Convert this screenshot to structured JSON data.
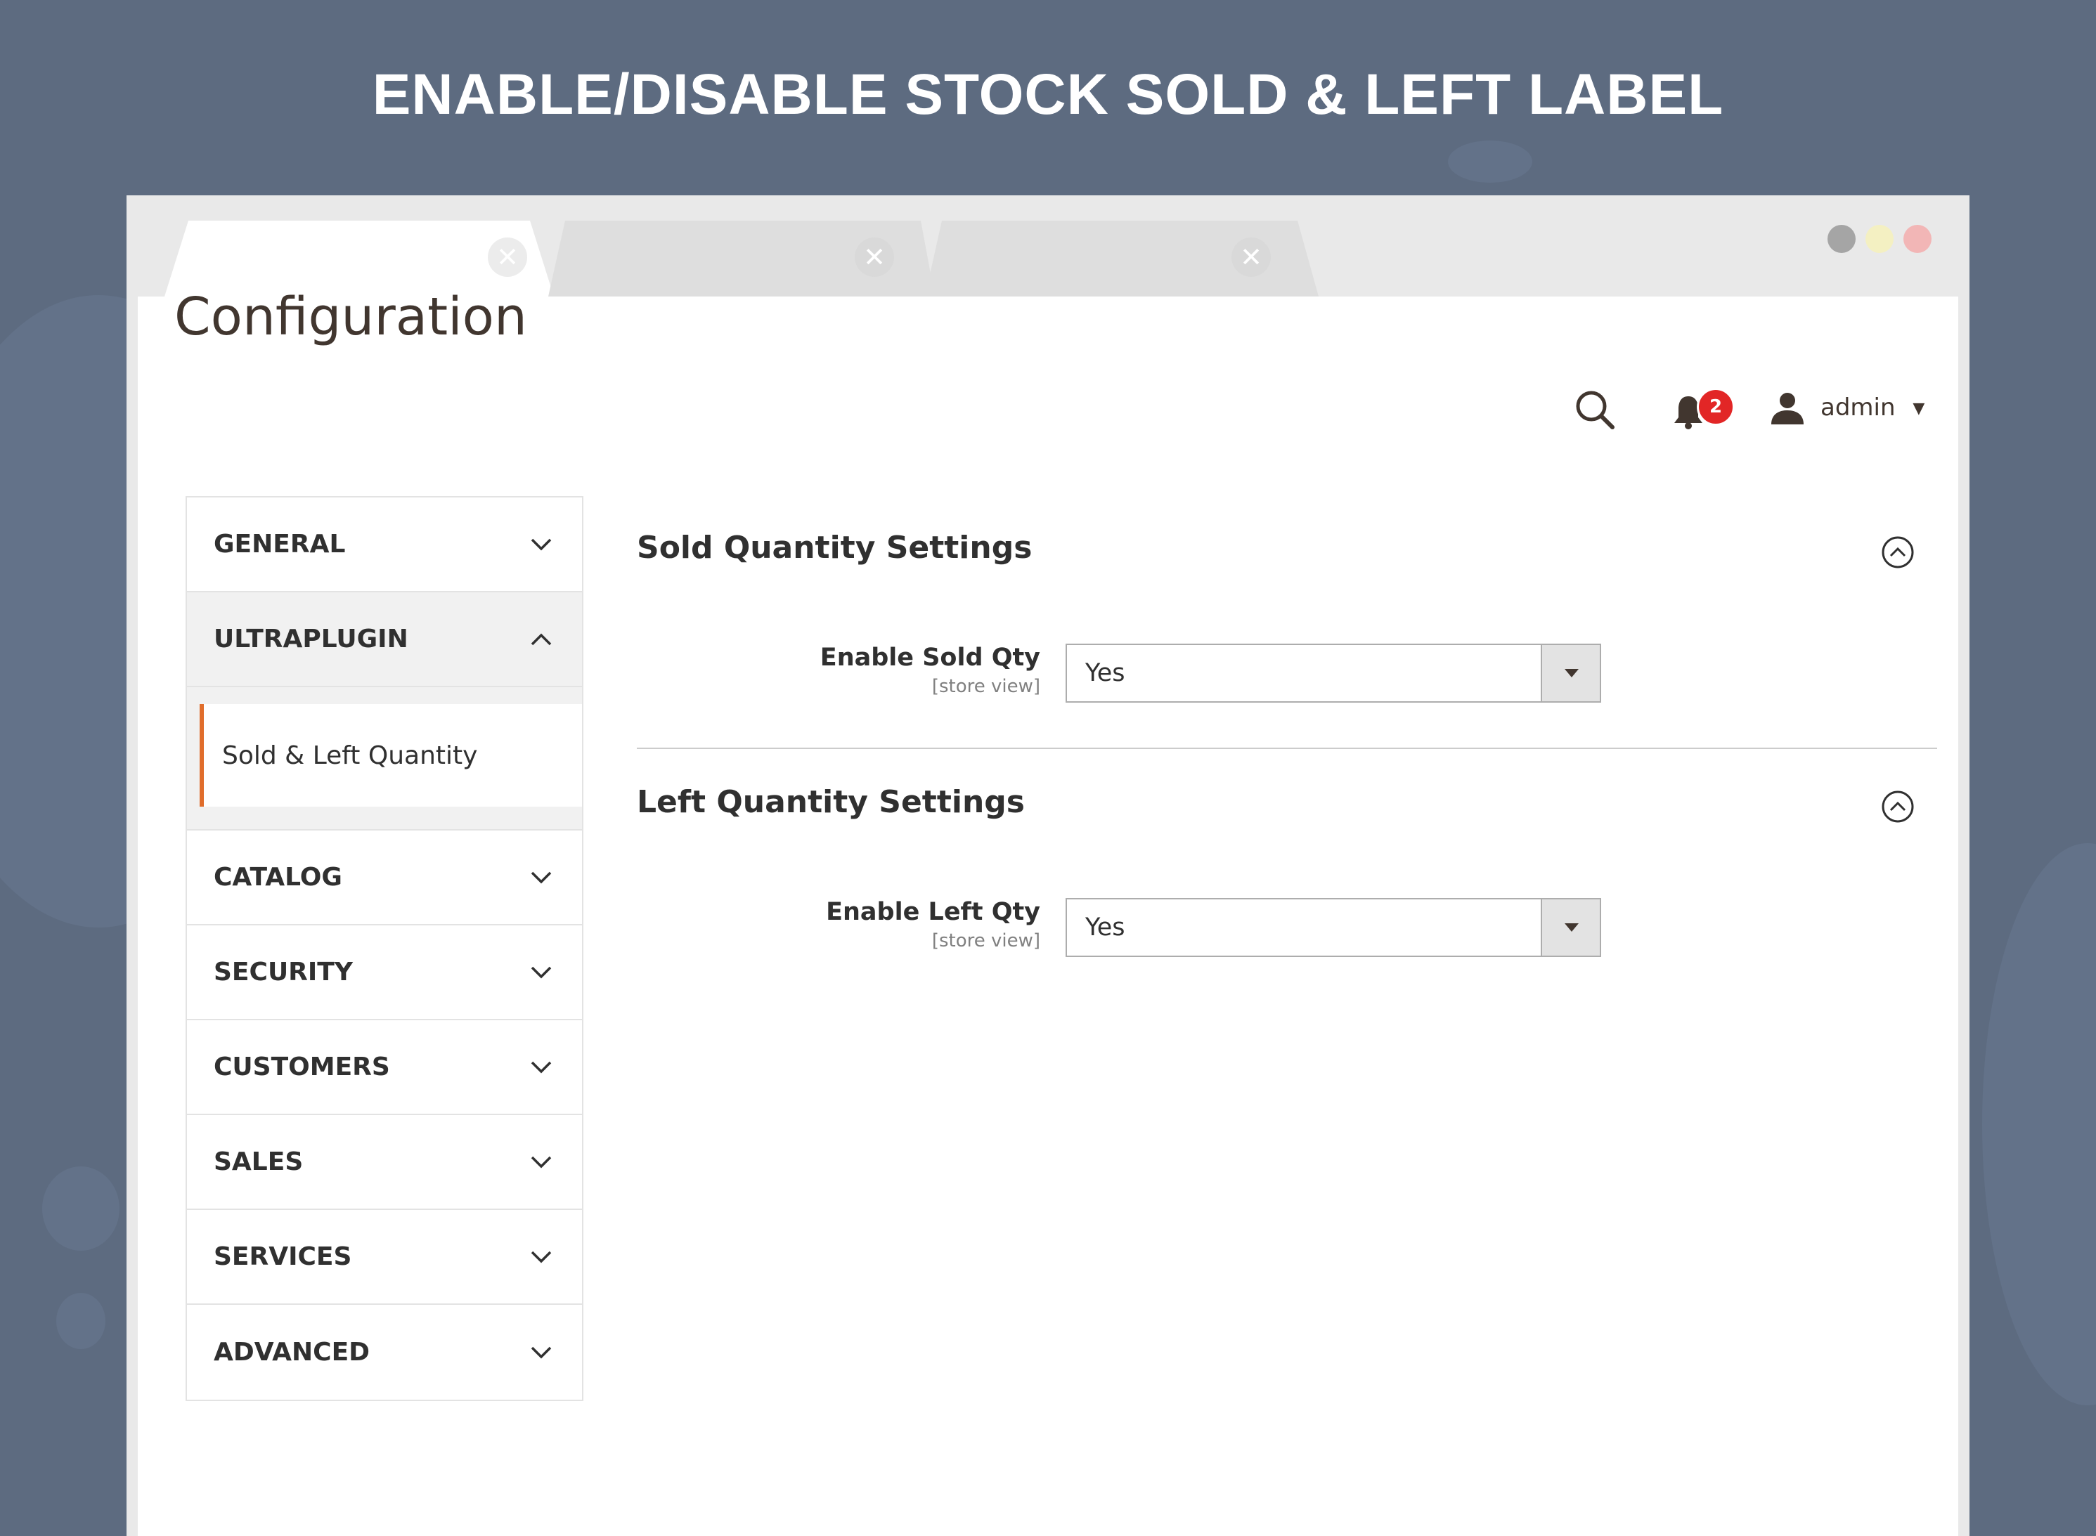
{
  "banner": {
    "title": "ENABLE/DISABLE STOCK SOLD & LEFT LABEL"
  },
  "window": {
    "tabs": [
      {
        "close_icon": "close-icon"
      },
      {
        "close_icon": "close-icon"
      },
      {
        "close_icon": "close-icon"
      }
    ],
    "controls": [
      "minimize-dot",
      "maximize-dot",
      "close-dot"
    ]
  },
  "header": {
    "page_title": "Configuration",
    "notification_count": "2",
    "user_name": "admin"
  },
  "sidebar": {
    "groups": [
      {
        "label": "GENERAL",
        "expanded": false
      },
      {
        "label": "ULTRAPLUGIN",
        "expanded": true,
        "items": [
          {
            "label": "Sold & Left Quantity",
            "active": true
          }
        ]
      },
      {
        "label": "CATALOG",
        "expanded": false
      },
      {
        "label": "SECURITY",
        "expanded": false
      },
      {
        "label": "CUSTOMERS",
        "expanded": false
      },
      {
        "label": "SALES",
        "expanded": false
      },
      {
        "label": "SERVICES",
        "expanded": false
      },
      {
        "label": "ADVANCED",
        "expanded": false
      }
    ]
  },
  "sections": [
    {
      "title": "Sold Quantity Settings",
      "field": {
        "label": "Enable Sold Qty",
        "scope": "[store view]",
        "value": "Yes"
      }
    },
    {
      "title": "Left Quantity Settings",
      "field": {
        "label": "Enable Left Qty",
        "scope": "[store view]",
        "value": "Yes"
      }
    }
  ],
  "colors": {
    "background": "#5d6b80",
    "accent": "#e06d2b",
    "badge": "#e22626",
    "text": "#303030"
  }
}
